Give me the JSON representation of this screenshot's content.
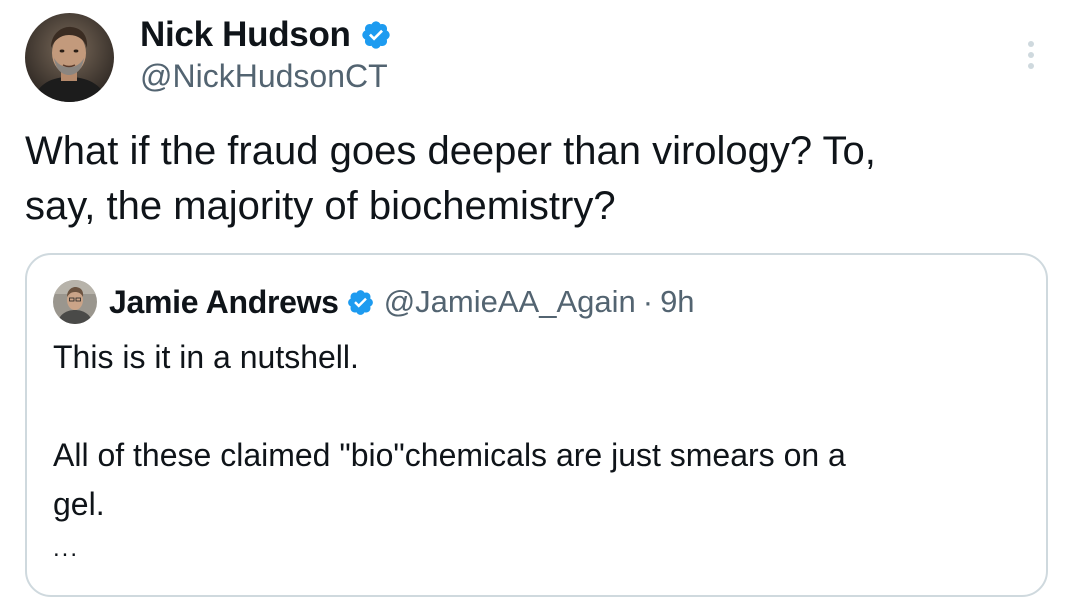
{
  "tweet": {
    "author": {
      "name": "Nick Hudson",
      "handle": "@NickHudsonCT",
      "verified_icon": "verified-badge-icon"
    },
    "more_icon": "more-vertical-icon",
    "text_line_1": "What if the fraud goes deeper than virology? To,",
    "text_line_2": "say, the majority of biochemistry?"
  },
  "quoted_tweet": {
    "author": {
      "name": "Jamie Andrews",
      "handle": "@JamieAA_Again",
      "verified_icon": "verified-badge-icon"
    },
    "separator": "·",
    "time": "9h",
    "line_1": "This is it in a nutshell.",
    "line_2": "All of these claimed \"bio\"chemicals are just smears on a",
    "line_3": "gel.",
    "ellipsis": "..."
  },
  "colors": {
    "text": "#0f1419",
    "secondary_text": "#536471",
    "verified_blue": "#1d9bf0",
    "border": "#cfd9de"
  }
}
